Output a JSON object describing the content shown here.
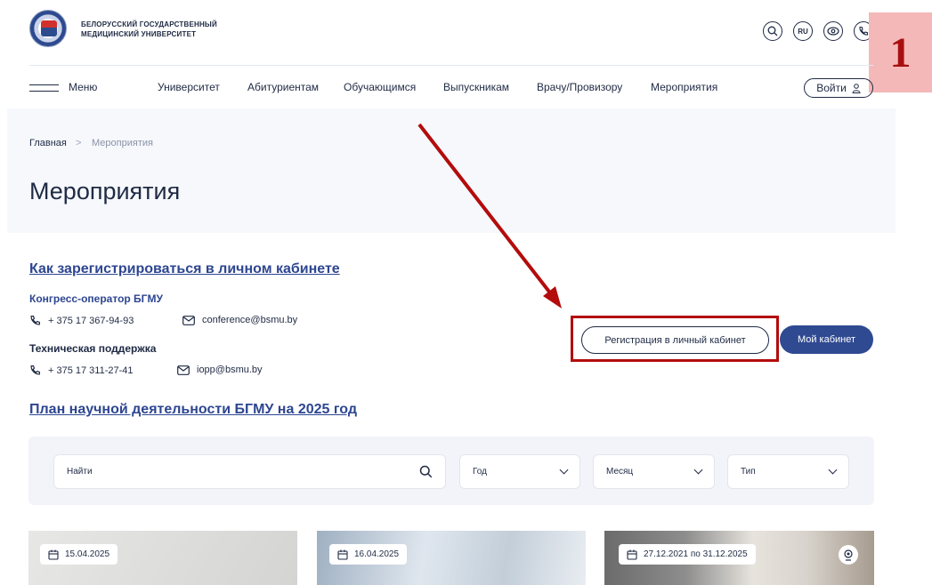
{
  "header": {
    "org_line1": "БЕЛОРУССКИЙ ГОСУДАРСТВЕННЫЙ",
    "org_line2": "МЕДИЦИНСКИЙ УНИВЕРСИТЕТ",
    "lang": "RU",
    "icons": [
      "search-icon",
      "language-icon",
      "eye-icon",
      "phone-icon"
    ]
  },
  "nav": {
    "menu_label": "Меню",
    "items": [
      "Университет",
      "Абитуриентам",
      "Обучающимся",
      "Выпускникам",
      "Врачу/Провизору",
      "Мероприятия"
    ],
    "login_label": "Войти"
  },
  "badge": {
    "number": "1"
  },
  "breadcrumb": {
    "home": "Главная",
    "separator": ">",
    "current": "Мероприятия"
  },
  "page": {
    "title": "Мероприятия"
  },
  "contacts": {
    "register_link": "Как зарегистрироваться в личном кабинете",
    "operator_title": "Конгресс-оператор БГМУ",
    "operator_phone": "+ 375 17 367-94-93",
    "operator_email": "conference@bsmu.by",
    "support_title": "Техническая поддержка",
    "support_phone": "+ 375 17 311-27-41",
    "support_email": "iopp@bsmu.by",
    "plan_link": "План научной деятельности БГМУ на 2025 год"
  },
  "actions": {
    "register_button": "Регистрация в личный кабинет",
    "cabinet_button": "Мой кабинет"
  },
  "filters": {
    "search_placeholder": "Найти",
    "year": "Год",
    "month": "Месяц",
    "type": "Тип"
  },
  "events": [
    {
      "date": "15.04.2025"
    },
    {
      "date": "16.04.2025"
    },
    {
      "date": "27.12.2021 по 31.12.2025"
    }
  ],
  "colors": {
    "primary": "#2f4a91",
    "annotation": "#b30c0c",
    "badge_bg": "#f4b8b8"
  }
}
